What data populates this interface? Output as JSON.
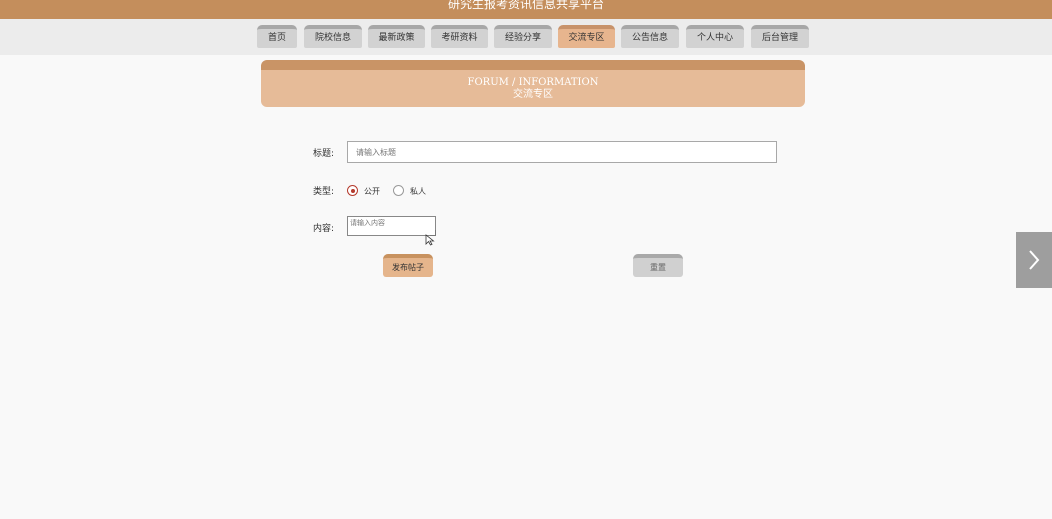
{
  "app": {
    "title": "研究生报考资讯信息共享平台"
  },
  "nav": {
    "tabs": [
      {
        "label": "首页",
        "active": false
      },
      {
        "label": "院校信息",
        "active": false
      },
      {
        "label": "最新政策",
        "active": false
      },
      {
        "label": "考研资料",
        "active": false
      },
      {
        "label": "经验分享",
        "active": false
      },
      {
        "label": "交流专区",
        "active": true
      },
      {
        "label": "公告信息",
        "active": false
      },
      {
        "label": "个人中心",
        "active": false
      },
      {
        "label": "后台管理",
        "active": false
      }
    ]
  },
  "banner": {
    "en": "FORUM / INFORMATION",
    "cn": "交流专区"
  },
  "form": {
    "title_label": "标题:",
    "title_placeholder": "请输入标题",
    "type_label": "类型:",
    "type_options": [
      {
        "label": "公开",
        "checked": true
      },
      {
        "label": "私人",
        "checked": false
      }
    ],
    "content_label": "内容:",
    "content_placeholder": "请输入内容",
    "publish_label": "发布帖子",
    "reset_label": "重置"
  },
  "colors": {
    "accent": "#c48e5c",
    "active_tab": "#e7b58e",
    "radio_checked": "#b53b2d"
  },
  "icons": {
    "next": "chevron-right-icon",
    "cursor": "mouse-pointer-icon"
  }
}
